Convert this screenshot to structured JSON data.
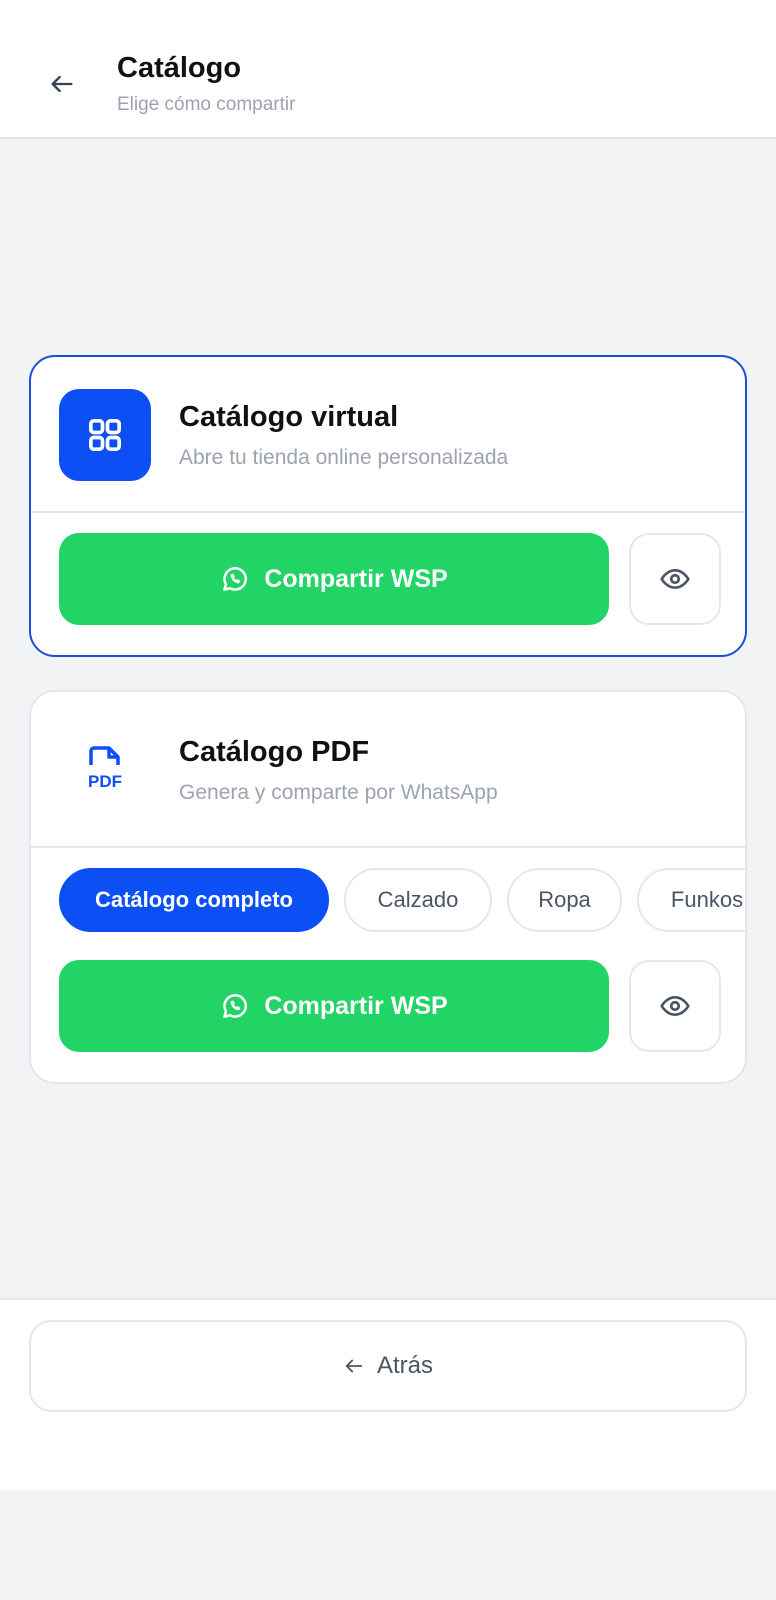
{
  "header": {
    "title": "Catálogo",
    "subtitle": "Elige cómo compartir",
    "back_icon": "arrow-left-icon"
  },
  "virtual_card": {
    "title": "Catálogo virtual",
    "subtitle": "Abre tu tienda online personalizada",
    "icon": "grid-icon",
    "share_label": "Compartir WSP",
    "preview_icon": "eye-icon",
    "selected": true
  },
  "pdf_card": {
    "title": "Catálogo PDF",
    "subtitle": "Genera y comparte por WhatsApp",
    "icon": "pdf-file-icon",
    "icon_text": "PDF",
    "chips": [
      {
        "label": "Catálogo completo",
        "active": true
      },
      {
        "label": "Calzado",
        "active": false
      },
      {
        "label": "Ropa",
        "active": false
      },
      {
        "label": "Funkos",
        "active": false
      }
    ],
    "share_label": "Compartir WSP",
    "preview_icon": "eye-icon"
  },
  "footer": {
    "back_label": "Atrás",
    "back_icon": "arrow-left-icon"
  },
  "colors": {
    "accent_blue": "#0b4ff5",
    "selected_border": "#1d4ed8",
    "whatsapp_green": "#22d366",
    "background": "#f2f3f5"
  }
}
